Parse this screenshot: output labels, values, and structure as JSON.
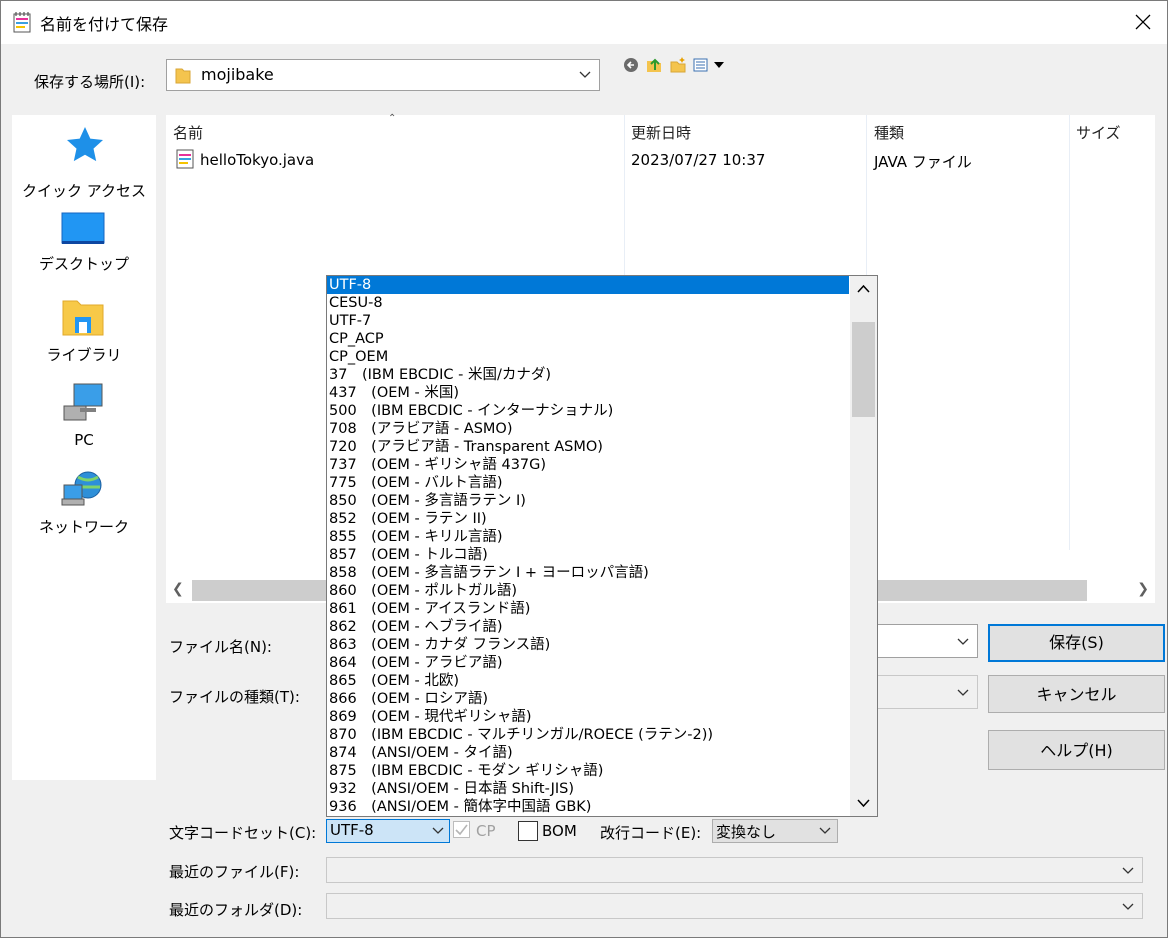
{
  "window": {
    "title": "名前を付けて保存"
  },
  "location": {
    "label": "保存する場所(I):",
    "folder": "mojibake"
  },
  "toolbar": {
    "icons": [
      "back-icon",
      "up-folder-icon",
      "new-folder-icon",
      "view-menu-icon"
    ]
  },
  "places": [
    {
      "label": "クイック アクセス",
      "icon": "star-icon"
    },
    {
      "label": "デスクトップ",
      "icon": "desktop-icon"
    },
    {
      "label": "ライブラリ",
      "icon": "library-icon"
    },
    {
      "label": "PC",
      "icon": "pc-icon"
    },
    {
      "label": "ネットワーク",
      "icon": "network-icon"
    }
  ],
  "filelist": {
    "columns": [
      "名前",
      "更新日時",
      "種類",
      "サイズ"
    ],
    "rows": [
      {
        "name": "helloTokyo.java",
        "modified": "2023/07/27 10:37",
        "type": "JAVA ファイル",
        "size": ""
      }
    ]
  },
  "form": {
    "filename_label": "ファイル名(N):",
    "filetype_label": "ファイルの種類(T):",
    "charset_label": "文字コードセット(C):",
    "charset_value": "UTF-8",
    "cp_label": "CP",
    "cp_checked": true,
    "bom_label": "BOM",
    "bom_checked": false,
    "newline_label": "改行コード(E):",
    "newline_value": "変換なし",
    "recent_file_label": "最近のファイル(F):",
    "recent_folder_label": "最近のフォルダ(D):"
  },
  "buttons": {
    "save": "保存(S)",
    "cancel": "キャンセル",
    "help": "ヘルプ(H)"
  },
  "charset_options": [
    "UTF-8",
    "CESU-8",
    "UTF-7",
    "CP_ACP",
    "CP_OEM",
    "37　(IBM EBCDIC - 米国/カナダ)",
    "437　(OEM - 米国)",
    "500　(IBM EBCDIC - インターナショナル)",
    "708　(アラビア語 - ASMO)",
    "720　(アラビア語 - Transparent ASMO)",
    "737　(OEM - ギリシャ語 437G)",
    "775　(OEM - バルト言語)",
    "850　(OEM - 多言語ラテン I)",
    "852　(OEM - ラテン II)",
    "855　(OEM - キリル言語)",
    "857　(OEM - トルコ語)",
    "858　(OEM - 多言語ラテン I + ヨーロッパ言語)",
    "860　(OEM - ポルトガル語)",
    "861　(OEM - アイスランド語)",
    "862　(OEM - ヘブライ語)",
    "863　(OEM - カナダ フランス語)",
    "864　(OEM - アラビア語)",
    "865　(OEM - 北欧)",
    "866　(OEM - ロシア語)",
    "869　(OEM - 現代ギリシャ語)",
    "870　(IBM EBCDIC - マルチリンガル/ROECE (ラテン-2))",
    "874　(ANSI/OEM - タイ語)",
    "875　(IBM EBCDIC - モダン ギリシャ語)",
    "932　(ANSI/OEM - 日本語 Shift-JIS)",
    "936　(ANSI/OEM - 簡体字中国語 GBK)"
  ],
  "charset_selected_index": 0,
  "colors": {
    "accent": "#0078d7",
    "dialog_bg": "#f0f0f0"
  }
}
